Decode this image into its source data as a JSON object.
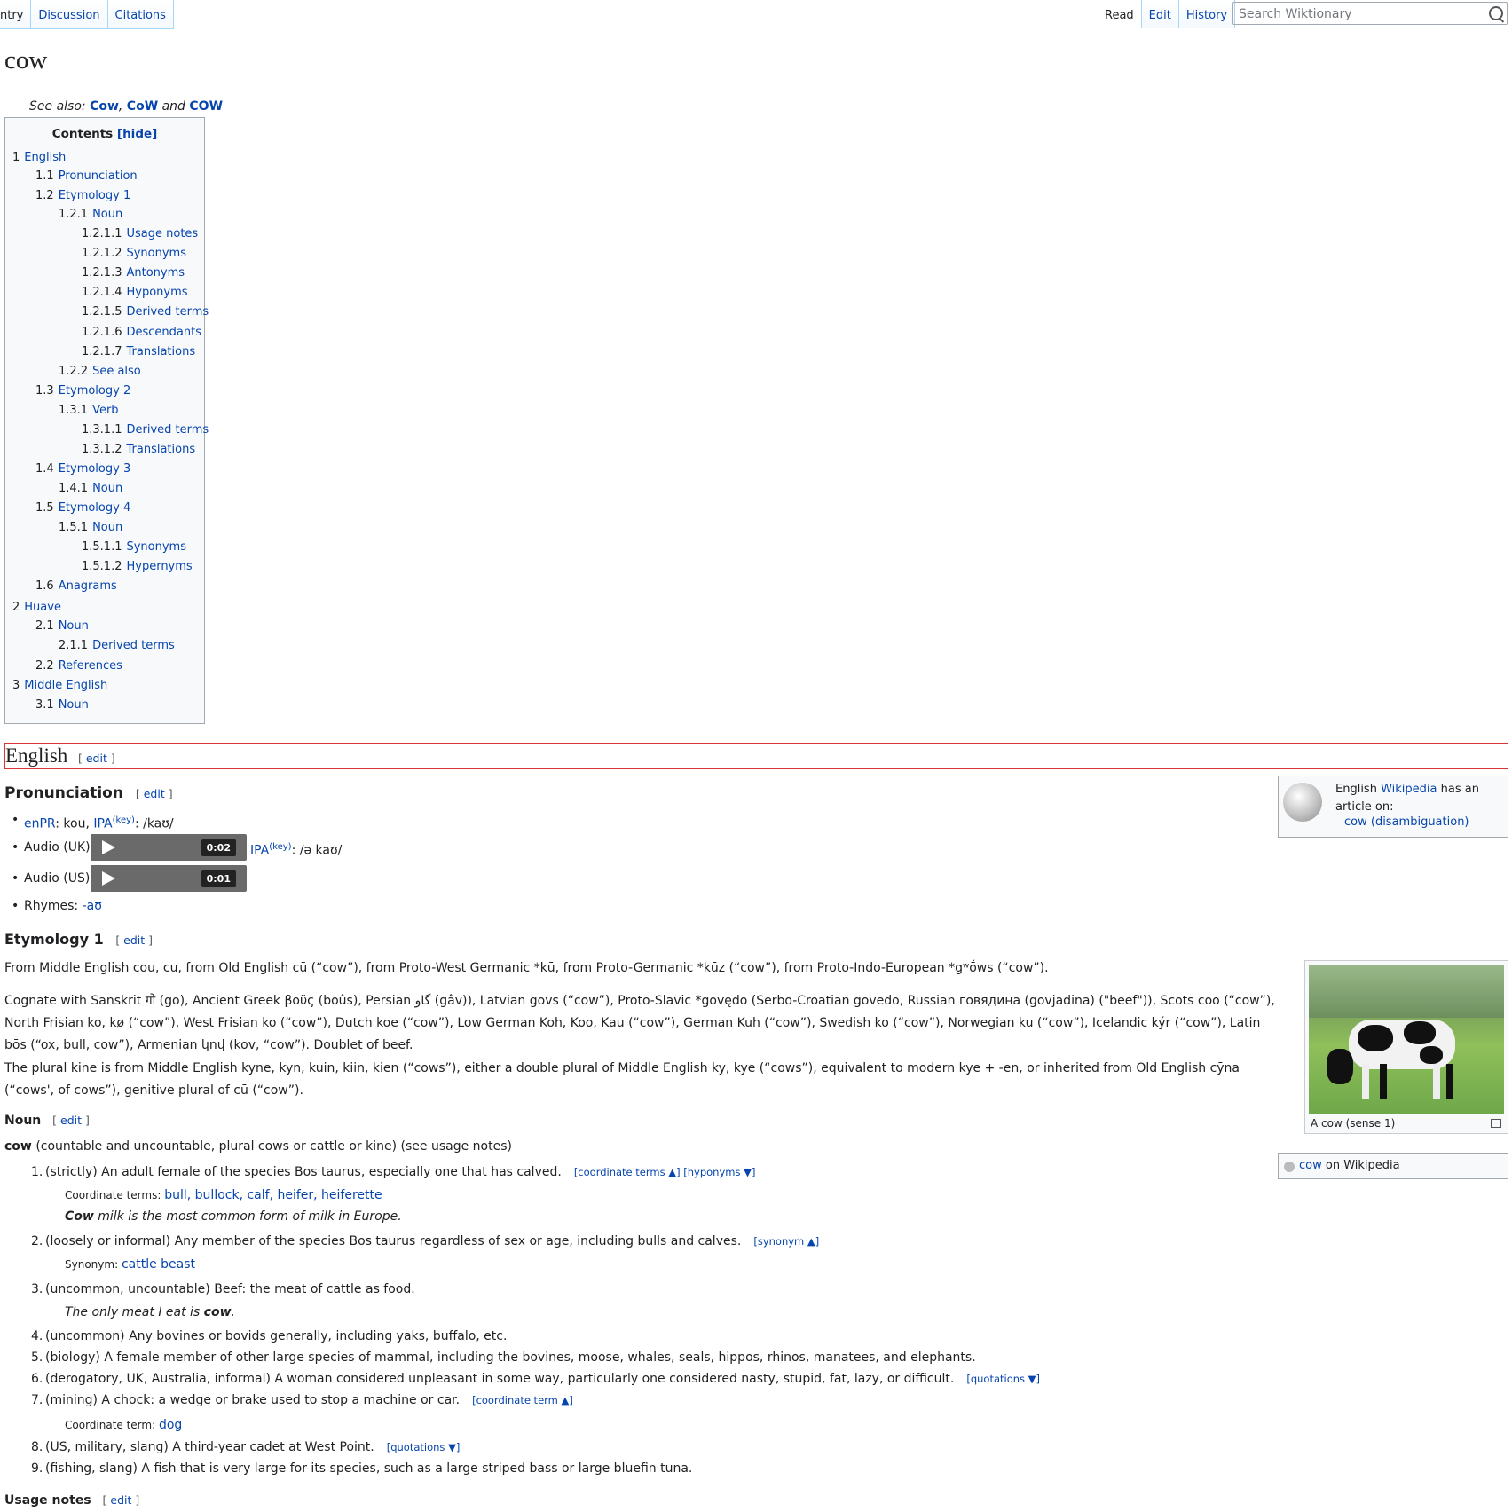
{
  "tabs_left": [
    "ntry",
    "Discussion",
    "Citations"
  ],
  "tabs_right": [
    "Read",
    "Edit",
    "History"
  ],
  "search": {
    "placeholder": "Search Wiktionary"
  },
  "title": "cow",
  "see_also": {
    "prefix": "See also:",
    "items": [
      "Cow",
      "CoW",
      "COW"
    ],
    "sep1": ",",
    "and": "and"
  },
  "toc": {
    "title": "Contents",
    "hide": "[hide]",
    "items": [
      {
        "num": "1",
        "label": "English",
        "level": 0
      },
      {
        "num": "1.1",
        "label": "Pronunciation",
        "level": 1
      },
      {
        "num": "1.2",
        "label": "Etymology 1",
        "level": 1
      },
      {
        "num": "1.2.1",
        "label": "Noun",
        "level": 2
      },
      {
        "num": "1.2.1.1",
        "label": "Usage notes",
        "level": 3
      },
      {
        "num": "1.2.1.2",
        "label": "Synonyms",
        "level": 3
      },
      {
        "num": "1.2.1.3",
        "label": "Antonyms",
        "level": 3
      },
      {
        "num": "1.2.1.4",
        "label": "Hyponyms",
        "level": 3
      },
      {
        "num": "1.2.1.5",
        "label": "Derived terms",
        "level": 3
      },
      {
        "num": "1.2.1.6",
        "label": "Descendants",
        "level": 3
      },
      {
        "num": "1.2.1.7",
        "label": "Translations",
        "level": 3
      },
      {
        "num": "1.2.2",
        "label": "See also",
        "level": 2
      },
      {
        "num": "1.3",
        "label": "Etymology 2",
        "level": 1
      },
      {
        "num": "1.3.1",
        "label": "Verb",
        "level": 2
      },
      {
        "num": "1.3.1.1",
        "label": "Derived terms",
        "level": 3
      },
      {
        "num": "1.3.1.2",
        "label": "Translations",
        "level": 3
      },
      {
        "num": "1.4",
        "label": "Etymology 3",
        "level": 1
      },
      {
        "num": "1.4.1",
        "label": "Noun",
        "level": 2
      },
      {
        "num": "1.5",
        "label": "Etymology 4",
        "level": 1
      },
      {
        "num": "1.5.1",
        "label": "Noun",
        "level": 2
      },
      {
        "num": "1.5.1.1",
        "label": "Synonyms",
        "level": 3
      },
      {
        "num": "1.5.1.2",
        "label": "Hypernyms",
        "level": 3
      },
      {
        "num": "1.6",
        "label": "Anagrams",
        "level": 1
      },
      {
        "num": "2",
        "label": "Huave",
        "level": 0
      },
      {
        "num": "2.1",
        "label": "Noun",
        "level": 1
      },
      {
        "num": "2.1.1",
        "label": "Derived terms",
        "level": 2
      },
      {
        "num": "2.2",
        "label": "References",
        "level": 1
      },
      {
        "num": "3",
        "label": "Middle English",
        "level": 0
      },
      {
        "num": "3.1",
        "label": "Noun",
        "level": 1
      }
    ]
  },
  "edit_label": "edit",
  "english_heading": "English",
  "pronunciation": {
    "heading": "Pronunciation",
    "enpr_label": "enPR",
    "enpr_value": ": kou,",
    "ipa_label": "IPA",
    "key": "(key)",
    "ipa_value": ": /kaʊ/",
    "audio_uk_label": "Audio (UK)",
    "audio_uk_duration": "0:02",
    "ipa_uk_value": ": /ə kaʊ/",
    "audio_us_label": "Audio (US)",
    "audio_us_duration": "0:01",
    "rhymes_label": "Rhymes:",
    "rhymes_value": "-aʊ"
  },
  "wikipedia_box": {
    "text_pre": "English",
    "link": "Wikipedia",
    "text_post": "has an article on:",
    "article": "cow (disambiguation)"
  },
  "etymology1": {
    "heading": "Etymology 1",
    "para1": "From Middle English cou, cu, from Old English cū (“cow”), from Proto-West Germanic *kū, from Proto-Germanic *kūz (“cow”), from Proto-Indo-European *gʷṓws (“cow”).",
    "para2": "Cognate with Sanskrit गो (go), Ancient Greek βοῦς (boûs), Persian گاو (gâv)), Latvian govs (“cow”), Proto-Slavic *govędo (Serbo-Croatian govedo, Russian говядина (govjadina) (\"beef\")), Scots coo (“cow”), North Frisian ko, kø (“cow”), West Frisian ko (“cow”), Dutch koe (“cow”), Low German Koh, Koo, Kau (“cow”), German Kuh (“cow”), Swedish ko (“cow”), Norwegian ku (“cow”), Icelandic kýr (“cow”), Latin bōs (“ox, bull, cow”), Armenian կով (kov, “cow”). Doublet of beef.",
    "para3": "The plural kine is from Middle English kyne, kyn, kuin, kiin, kien (“cows”), either a double plural of Middle English ky, kye (“cows”), equivalent to modern kye + -en, or inherited from Old English cȳna (“cows', of cows”), genitive plural of cū (“cow”)."
  },
  "image": {
    "caption": "A cow (sense 1)"
  },
  "wp_small": {
    "link": "cow",
    "text": "on Wikipedia"
  },
  "noun": {
    "heading": "Noun",
    "headword": "cow",
    "headline_rest": "(countable and uncountable, plural cows or cattle or kine) (see usage notes)",
    "senses": [
      {
        "num": "1.",
        "text": "(strictly) An adult female of the species Bos taurus, especially one that has calved.",
        "tags": "[coordinate terms ▲] [hyponyms ▼]"
      },
      {
        "num": "2.",
        "text": "(loosely or informal) Any member of the species Bos taurus regardless of sex or age, including bulls and calves.",
        "tags": "[synonym ▲]"
      },
      {
        "num": "3.",
        "text": "(uncommon, uncountable) Beef: the meat of cattle as food.",
        "tags": ""
      },
      {
        "num": "4.",
        "text": "(uncommon) Any bovines or bovids generally, including yaks, buffalo, etc.",
        "tags": ""
      },
      {
        "num": "5.",
        "text": "(biology) A female member of other large species of mammal, including the bovines, moose, whales, seals, hippos, rhinos, manatees, and elephants.",
        "tags": ""
      },
      {
        "num": "6.",
        "text": "(derogatory, UK, Australia, informal) A woman considered unpleasant in some way, particularly one considered nasty, stupid, fat, lazy, or difficult.",
        "tags": "[quotations ▼]"
      },
      {
        "num": "7.",
        "text": "(mining) A chock: a wedge or brake used to stop a machine or car.",
        "tags": "[coordinate term ▲]"
      },
      {
        "num": "8.",
        "text": "(US, military, slang) A third-year cadet at West Point.",
        "tags": "[quotations ▼]"
      },
      {
        "num": "9.",
        "text": "(fishing, slang) A fish that is very large for its species, such as a large striped bass or large bluefin tuna.",
        "tags": ""
      }
    ],
    "sub1_label": "Coordinate terms:",
    "sub1_value": "bull, bullock, calf, heifer, heiferette",
    "ex1_bold": "Cow",
    "ex1_rest": "milk is the most common form of milk in Europe.",
    "sub2_label": "Synonym:",
    "sub2_value": "cattle beast",
    "ex3_pre": "The only meat I eat is",
    "ex3_bold": "cow",
    "ex3_post": ".",
    "sub7_label": "Coordinate term:",
    "sub7_value": "dog"
  },
  "usage_notes": {
    "heading": "Usage notes"
  }
}
